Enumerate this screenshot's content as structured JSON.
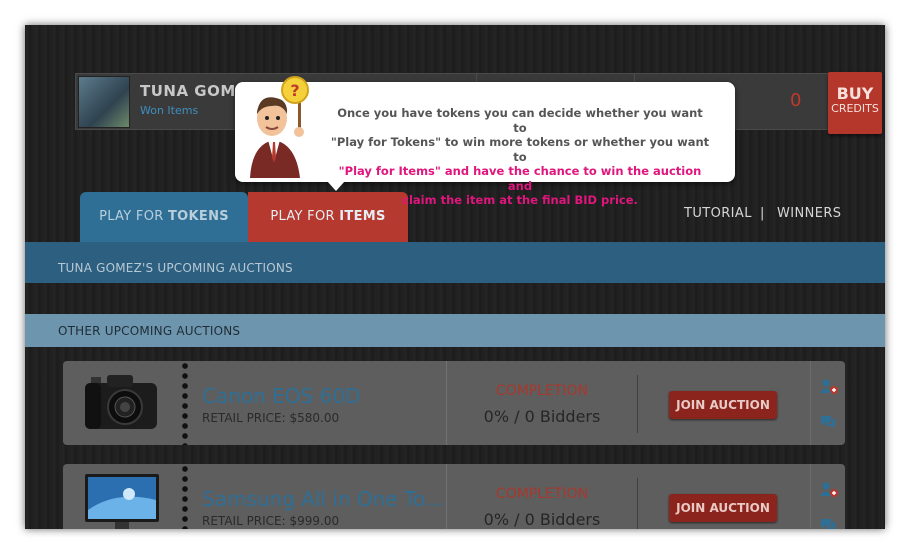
{
  "profile": {
    "name": "TUNA GOMEZ",
    "won_items": "Won Items",
    "count": "0",
    "buy_line1": "BUY",
    "buy_line2": "CREDITS"
  },
  "tooltip": {
    "line1": "Once you have tokens you can decide whether you want to",
    "line2": "\"Play for Tokens\" to win more tokens or whether you want to",
    "line3": "\"Play for Items\" and have the chance to win the auction and",
    "line4": "claim the item at the final BID price."
  },
  "tabs": {
    "tokens_pre": "PLAY FOR ",
    "tokens_bold": "TOKENS",
    "items_pre": "PLAY FOR ",
    "items_bold": "ITEMS"
  },
  "links": {
    "tutorial": "TUTORIAL",
    "separator": "|",
    "winners": "WINNERS"
  },
  "sections": {
    "upcoming_user": "TUNA GOMEZ'S UPCOMING AUCTIONS",
    "other_upcoming": "OTHER UPCOMING AUCTIONS"
  },
  "auctions": [
    {
      "title": "Canon EOS 60D",
      "retail": "RETAIL PRICE: $580.00",
      "completion_label": "COMPLETION",
      "progress": "0% / 0 Bidders",
      "join": "JOIN AUCTION"
    },
    {
      "title": "Samsung All in One To...",
      "retail": "RETAIL PRICE: $999.00",
      "completion_label": "COMPLETION",
      "progress": "0% / 0 Bidders",
      "join": "JOIN AUCTION"
    }
  ],
  "icons": {
    "add_user": "add-user-icon",
    "comments": "comments-icon",
    "help": "question-mark-icon"
  },
  "colors": {
    "accent_blue": "#2f6f96",
    "accent_red": "#b5392f",
    "tooltip_highlight": "#e0157d"
  }
}
